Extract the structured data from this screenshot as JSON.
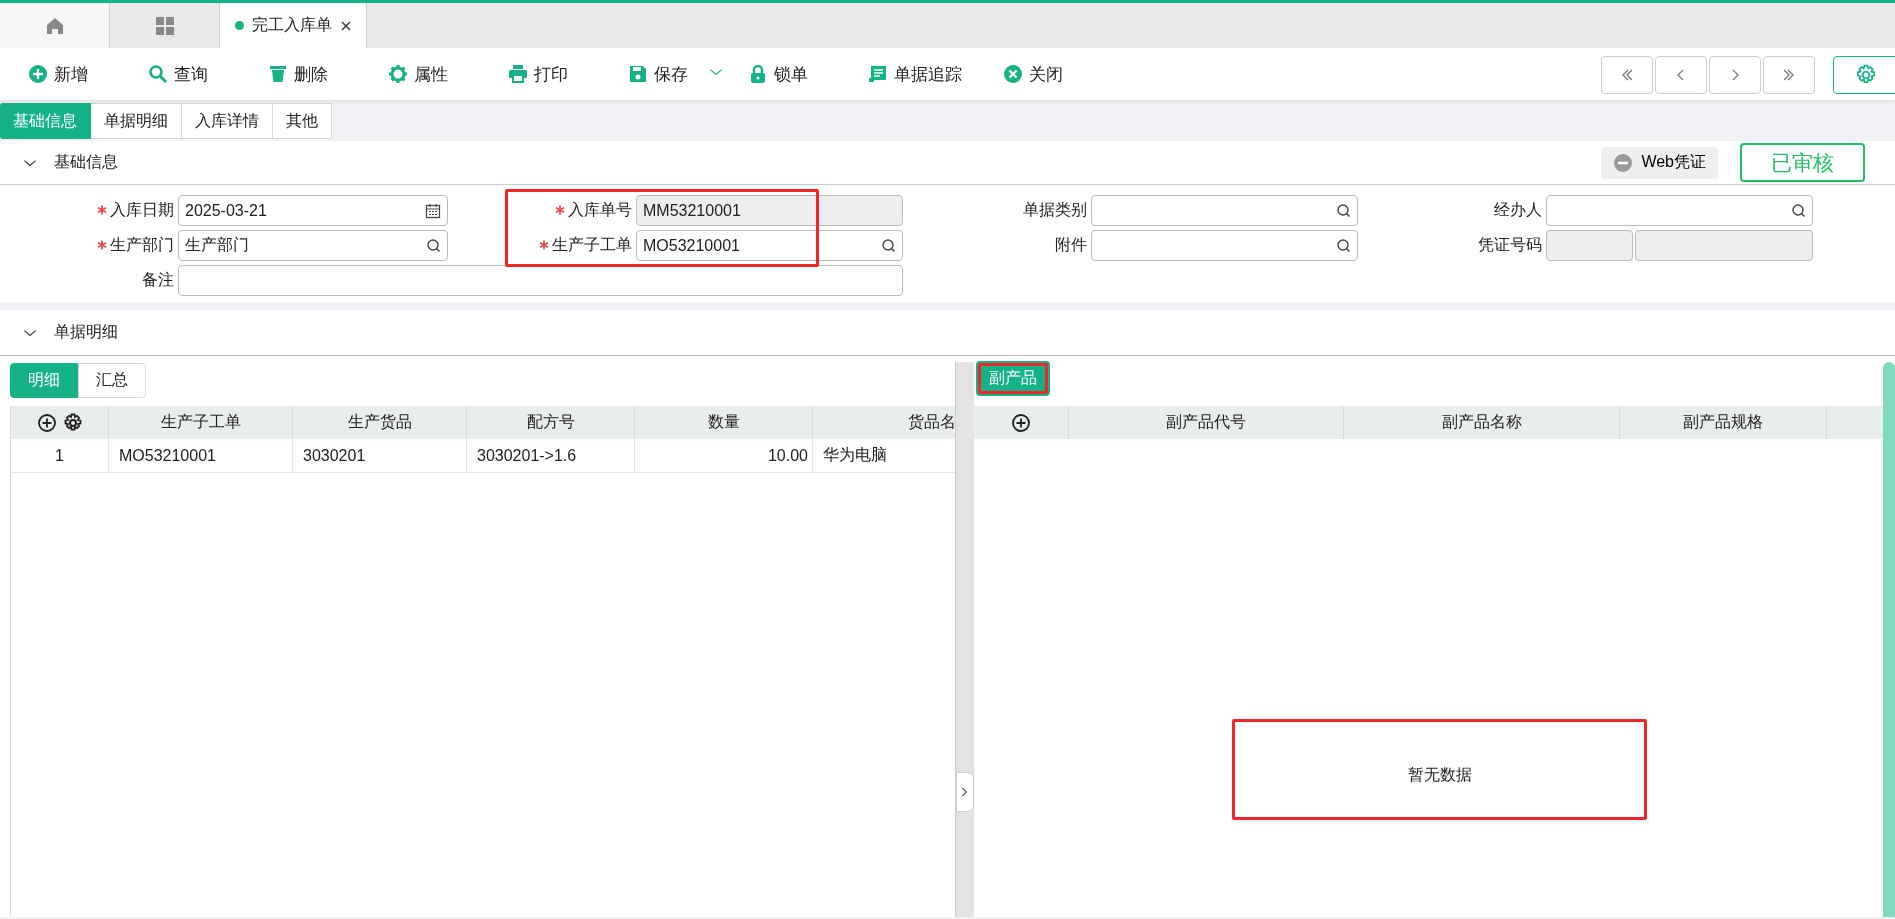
{
  "page_tabs": [
    {
      "kind": "home",
      "selected": false
    },
    {
      "kind": "apps",
      "selected": false
    },
    {
      "kind": "document",
      "label": "完工入库单",
      "selected": true
    }
  ],
  "toolbar": [
    {
      "kind": "add",
      "label": "新增"
    },
    {
      "kind": "search",
      "label": "查询"
    },
    {
      "kind": "delete",
      "label": "删除"
    },
    {
      "kind": "settings",
      "label": "属性"
    },
    {
      "kind": "print",
      "label": "打印"
    },
    {
      "kind": "save",
      "label": "保存",
      "dropdown": true
    },
    {
      "kind": "lock",
      "label": "锁单"
    },
    {
      "kind": "trace",
      "label": "单据追踪"
    },
    {
      "kind": "close",
      "label": "关闭"
    }
  ],
  "nav_buttons": [
    {
      "kind": "first"
    },
    {
      "kind": "prev"
    },
    {
      "kind": "next"
    },
    {
      "kind": "last"
    }
  ],
  "form_tabs": [
    {
      "label": "基础信息",
      "selected": true
    },
    {
      "label": "单据明细",
      "selected": false
    },
    {
      "label": "入库详情",
      "selected": false
    },
    {
      "label": "其他",
      "selected": false
    }
  ],
  "basic_info": {
    "title": "基础信息",
    "voucher_button": "Web凭证",
    "status": "已审核",
    "fields": [
      {
        "label": "入库日期",
        "required": true,
        "kind": "date",
        "value": "2025-03-21"
      },
      {
        "label": "入库单号",
        "required": true,
        "kind": "readonly",
        "value": "MM53210001",
        "highlighted": true
      },
      {
        "label": "单据类别",
        "required": false,
        "kind": "lookup"
      },
      {
        "label": "经办人",
        "required": false,
        "kind": "lookup"
      },
      {
        "label": "生产部门",
        "required": true,
        "kind": "lookup",
        "value": "生产部门"
      },
      {
        "label": "生产子工单",
        "required": true,
        "kind": "lookup",
        "value": "MO53210001",
        "highlighted": true
      },
      {
        "label": "附件",
        "required": false,
        "kind": "lookup"
      },
      {
        "label": "凭证号码",
        "required": false,
        "kind": "split"
      },
      {
        "label": "备注",
        "required": false,
        "kind": "wide"
      }
    ]
  },
  "detail": {
    "title": "单据明细",
    "view_tabs": [
      {
        "label": "明细",
        "selected": true
      },
      {
        "label": "汇总",
        "selected": false
      }
    ],
    "table": {
      "columns": [
        "生产子工单",
        "生产货品",
        "配方号",
        "数量",
        "货品名"
      ],
      "rows": [
        {
          "row_number": "1",
          "cells": [
            "MO53210001",
            "3030201",
            "3030201->1.6",
            "10.00",
            "华为电脑"
          ]
        }
      ]
    },
    "byproduct_tab": {
      "label": "副产品",
      "highlighted": true
    },
    "byproduct_table": {
      "columns": [
        "副产品代号",
        "副产品名称",
        "副产品规格"
      ],
      "empty_text": "暂无数据",
      "empty_highlighted": true
    }
  }
}
